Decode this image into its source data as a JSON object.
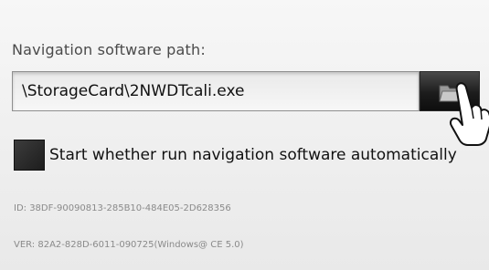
{
  "navigation": {
    "path_label": "Navigation software path:",
    "path_value": "\\StorageCard\\2NWDTcali.exe",
    "browse_icon": "folder-icon"
  },
  "autostart": {
    "label": "Start whether run navigation software automatically"
  },
  "info": {
    "id_text": "ID:  38DF-90090813-285B10-484E05-2D628356",
    "ver_text": "VER:  82A2-828D-6011-090725(Windows@ CE 5.0)"
  },
  "colors": {
    "background": "#f1f1f1",
    "button_dark": "#1c1c1c",
    "text": "#111111",
    "muted_text": "#8a8a8a"
  }
}
